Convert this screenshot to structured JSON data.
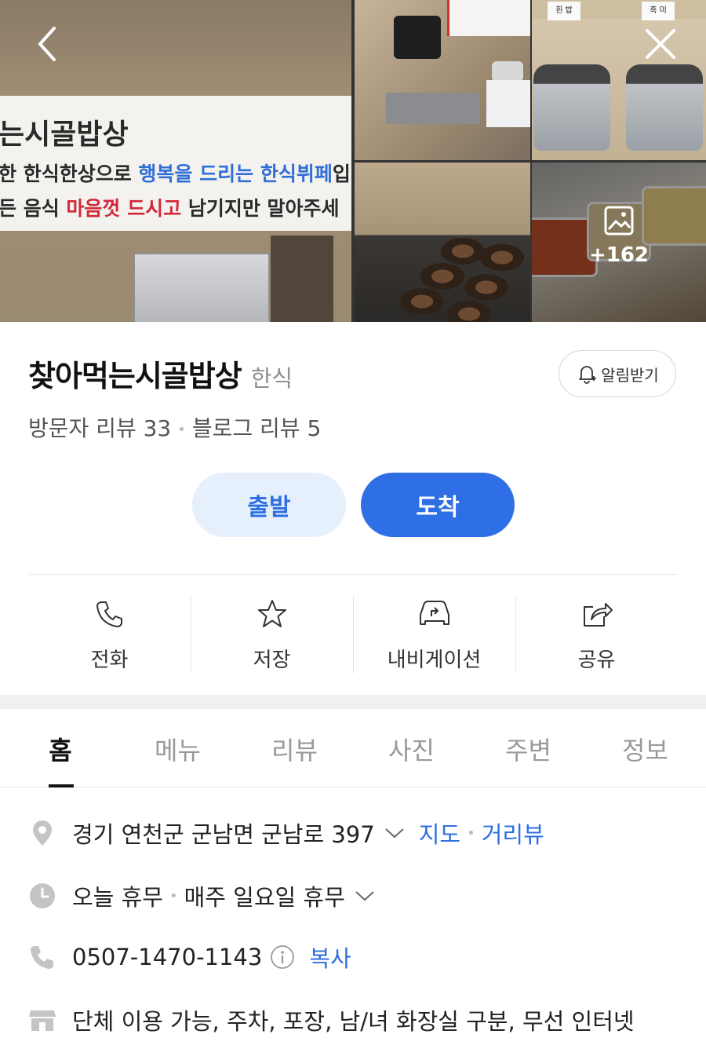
{
  "gallery": {
    "banner": {
      "line1": "는시골밥상",
      "line2_a": "한 한식한상으로 ",
      "line2_b": "행복을 드리는 한식뷔페",
      "line2_c": "입",
      "line3_a": "든 음식 ",
      "line3_b": "마음껏 드시고",
      "line3_c": " 남기지만 말아주세",
      "cooker_label_1": "흰 밥",
      "cooker_label_2": "흑 미"
    },
    "more_count": "+162"
  },
  "place": {
    "name": "찾아먹는시골밥상",
    "category": "한식",
    "alarm_label": "알림받기",
    "visitor_reviews": "방문자 리뷰 33",
    "blog_reviews": "블로그 리뷰 5"
  },
  "route": {
    "start_label": "출발",
    "arrive_label": "도착"
  },
  "actions": {
    "call": "전화",
    "save": "저장",
    "navigation": "내비게이션",
    "share": "공유"
  },
  "tabs": [
    "홈",
    "메뉴",
    "리뷰",
    "사진",
    "주변",
    "정보"
  ],
  "info": {
    "address": "경기 연천군 군남면 군남로 397",
    "map_link": "지도",
    "street_view_link": "거리뷰",
    "hours_status": "오늘 휴무",
    "hours_detail": "매주 일요일 휴무",
    "phone": "0507-1470-1143",
    "copy_label": "복사",
    "amenities": "단체 이용 가능, 주차, 포장, 남/녀 화장실 구분, 무선 인터넷"
  },
  "colors": {
    "accent": "#2f6fe6",
    "accent_light": "#e6f0fd",
    "icon_gray": "#c4c4c4"
  }
}
